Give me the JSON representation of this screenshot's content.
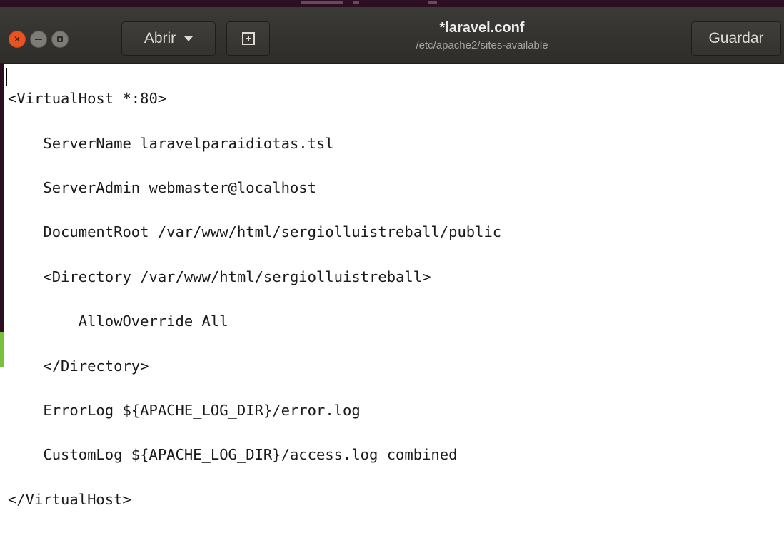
{
  "window": {
    "title": "*laravel.conf",
    "subtitle": "/etc/apache2/sites-available"
  },
  "toolbar": {
    "open_label": "Abrir",
    "save_label": "Guardar"
  },
  "icons": {
    "close": "close-icon",
    "minimize": "minimize-icon",
    "maximize": "maximize-icon",
    "open_menu": "chevron-down-icon",
    "new_document": "new-document-icon"
  },
  "colors": {
    "close_button": "#e95420",
    "headerbar": "#3b3a37",
    "editor_background": "#ffffff",
    "text": "#1a1a1a"
  },
  "editor": {
    "lines": [
      "<VirtualHost *:80>",
      "    ServerName laravelparaidiotas.tsl",
      "    ServerAdmin webmaster@localhost",
      "    DocumentRoot /var/www/html/sergiolluistreball/public",
      "    <Directory /var/www/html/sergiolluistreball>",
      "        AllowOverride All",
      "    </Directory>",
      "    ErrorLog ${APACHE_LOG_DIR}/error.log",
      "    CustomLog ${APACHE_LOG_DIR}/access.log combined",
      "</VirtualHost>"
    ]
  }
}
